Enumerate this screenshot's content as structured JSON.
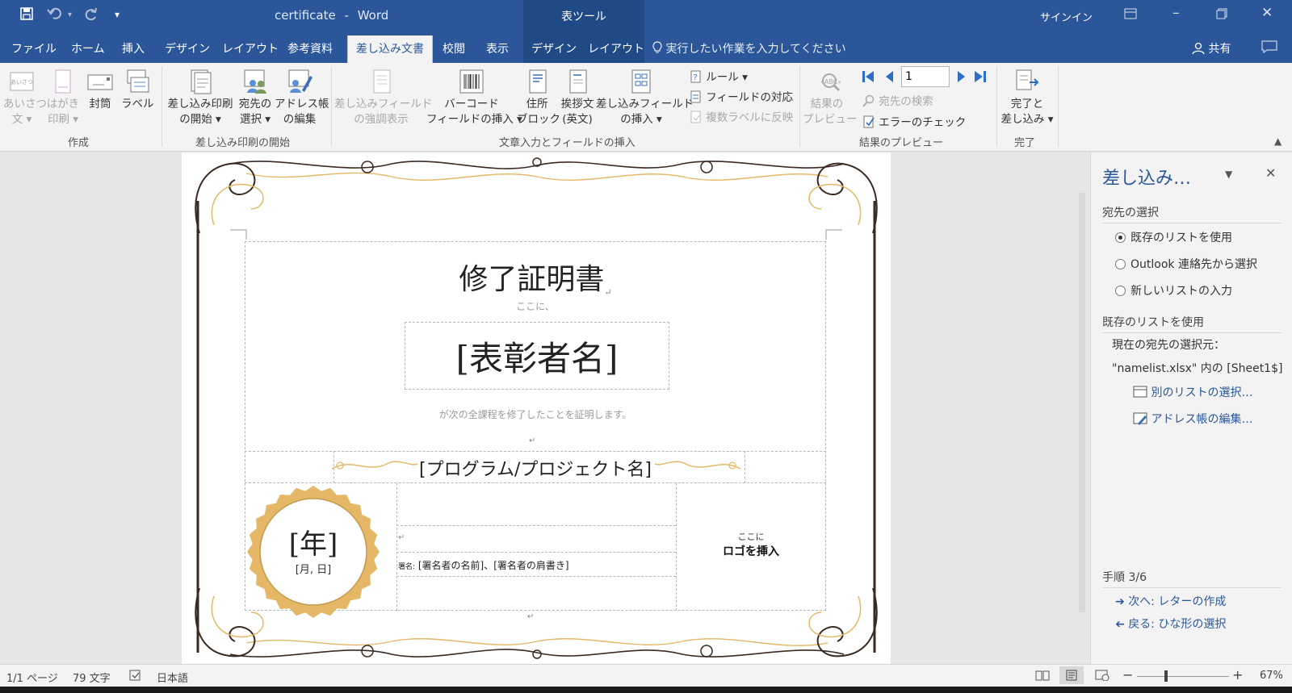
{
  "window": {
    "doc_name": "certificate",
    "separator": "-",
    "app_name": "Word",
    "context_tab_group": "表ツール",
    "signin": "サインイン"
  },
  "tabs": {
    "file": "ファイル",
    "home": "ホーム",
    "insert": "挿入",
    "design": "デザイン",
    "layout": "レイアウト",
    "references": "参考資料",
    "mailings": "差し込み文書",
    "review": "校閲",
    "view": "表示",
    "table_design": "デザイン",
    "table_layout": "レイアウト",
    "tell_me": "実行したい作業を入力してください",
    "share": "共有"
  },
  "ribbon": {
    "create": {
      "label": "作成",
      "greeting_1": "あいさつ",
      "greeting_2": "文 ▾",
      "postcard_1": "はがき",
      "postcard_2": "印刷 ▾",
      "envelope": "封筒",
      "label_btn": "ラベル"
    },
    "start": {
      "label": "差し込み印刷の開始",
      "start_merge_1": "差し込み印刷",
      "start_merge_2": "の開始 ▾",
      "select_recipients_1": "宛先の",
      "select_recipients_2": "選択 ▾",
      "edit_list_1": "アドレス帳",
      "edit_list_2": "の編集"
    },
    "fields": {
      "label": "文章入力とフィールドの挿入",
      "highlight_1": "差し込みフィールド",
      "highlight_2": "の強調表示",
      "barcode_1": "バーコード",
      "barcode_2": "フィールドの挿入 ▾",
      "address_1": "住所",
      "address_2": "ブロック",
      "greeting_1": "挨拶文",
      "greeting_2": "(英文)",
      "insert_field_1": "差し込みフィールド",
      "insert_field_2": "の挿入 ▾",
      "rules": "ルール ▾",
      "match_fields": "フィールドの対応",
      "update_labels": "複数ラベルに反映"
    },
    "preview": {
      "label": "結果のプレビュー",
      "preview_1": "結果の",
      "preview_2": "プレビュー",
      "record_number": "1",
      "find_recipient": "宛先の検索",
      "check_errors": "エラーのチェック"
    },
    "finish": {
      "label": "完了",
      "finish_1": "完了と",
      "finish_2": "差し込み ▾"
    }
  },
  "document": {
    "title": "修了証明書",
    "presented_to": "ここに、",
    "recipient": "[表彰者名]",
    "body": "が次の全課程を修了したことを証明します。",
    "program": "[プログラム/プロジェクト名]",
    "year": "[年]",
    "month_day": "[月, 日]",
    "signer_prefix": "署名:",
    "signer": "[署名者の名前]、[署名者の肩書き]",
    "logo_small": "ここに",
    "logo_big": "ロゴを挿入"
  },
  "pane": {
    "title": "差し込み…",
    "section_select": "宛先の選択",
    "opt_existing": "既存のリストを使用",
    "opt_outlook": "Outlook 連絡先から選択",
    "opt_new": "新しいリストの入力",
    "section_existing": "既存のリストを使用",
    "current_source": "現在の宛先の選択元：",
    "source_file": "\"namelist.xlsx\" 内の [Sheet1$]",
    "link_other_list": "別のリストの選択…",
    "link_edit_list": "アドレス帳の編集…",
    "step": "手順 3/6",
    "next": "次へ: レターの作成",
    "back": "戻る: ひな形の選択"
  },
  "status": {
    "page": "1/1 ページ",
    "words": "79 文字",
    "language": "日本語",
    "zoom": "67%"
  },
  "colors": {
    "title_blue": "#2b579a",
    "context_blue": "#1f4a86",
    "gold": "#e4b866",
    "flourish_dark": "#3b2a22"
  }
}
